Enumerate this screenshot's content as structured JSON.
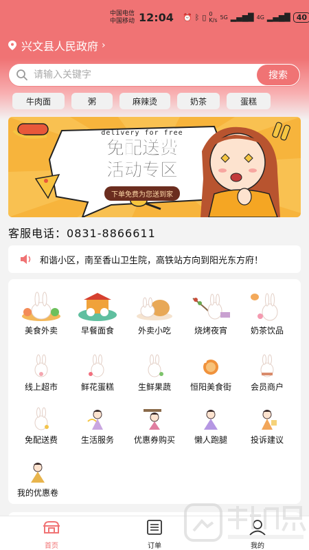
{
  "status_bar": {
    "carrier1": "中国电信",
    "carrier2": "中国移动",
    "time": "12:04",
    "net_speed": "0 K/s",
    "signal1": "5G",
    "signal2": "4G",
    "battery": "40"
  },
  "header": {
    "location": "兴文县人民政府"
  },
  "search": {
    "placeholder": "请输入关键字",
    "button": "搜索"
  },
  "tags": [
    "牛肉面",
    "粥",
    "麻辣烫",
    "奶茶",
    "蛋糕"
  ],
  "banner": {
    "line_small": "delivery for free",
    "title_line1": "免配送费",
    "title_line2": "活动专区",
    "strip": "下单免费为您送到家"
  },
  "contact": {
    "label": "客服电话：",
    "phone": "0831-8866611"
  },
  "notice": {
    "text": "和谐小区，南至香山卫生院，高铁站方向到阳光东方府！"
  },
  "categories": [
    {
      "label": "美食外卖",
      "icon": "rabbit-food-icon"
    },
    {
      "label": "早餐面食",
      "icon": "breakfast-bun-icon"
    },
    {
      "label": "外卖小吃",
      "icon": "snack-icon"
    },
    {
      "label": "烧烤夜宵",
      "icon": "bbq-icon"
    },
    {
      "label": "奶茶饮品",
      "icon": "milk-tea-icon"
    },
    {
      "label": "线上超市",
      "icon": "supermarket-rabbit-icon"
    },
    {
      "label": "鲜花蛋糕",
      "icon": "flower-cake-rabbit-icon"
    },
    {
      "label": "生鲜果蔬",
      "icon": "fresh-produce-rabbit-icon"
    },
    {
      "label": "恒阳美食街",
      "icon": "food-street-icon"
    },
    {
      "label": "会员商户",
      "icon": "member-merchant-rabbit-icon"
    },
    {
      "label": "免配送费",
      "icon": "free-delivery-rabbit-icon"
    },
    {
      "label": "生活服务",
      "icon": "life-service-fairy-icon"
    },
    {
      "label": "优惠券购买",
      "icon": "coupon-buy-fairy-icon"
    },
    {
      "label": "懒人跑腿",
      "icon": "errand-fairy-icon"
    },
    {
      "label": "投诉建议",
      "icon": "complaint-fairy-icon"
    },
    {
      "label": "我的优惠卷",
      "icon": "my-coupon-fairy-icon"
    }
  ],
  "nav": [
    {
      "label": "首页",
      "icon": "home-icon",
      "active": true
    },
    {
      "label": "订单",
      "icon": "order-list-icon",
      "active": false
    },
    {
      "label": "我的",
      "icon": "profile-icon",
      "active": false
    }
  ],
  "colors": {
    "accent": "#f07374",
    "banner_bg": "#f7b43c"
  }
}
